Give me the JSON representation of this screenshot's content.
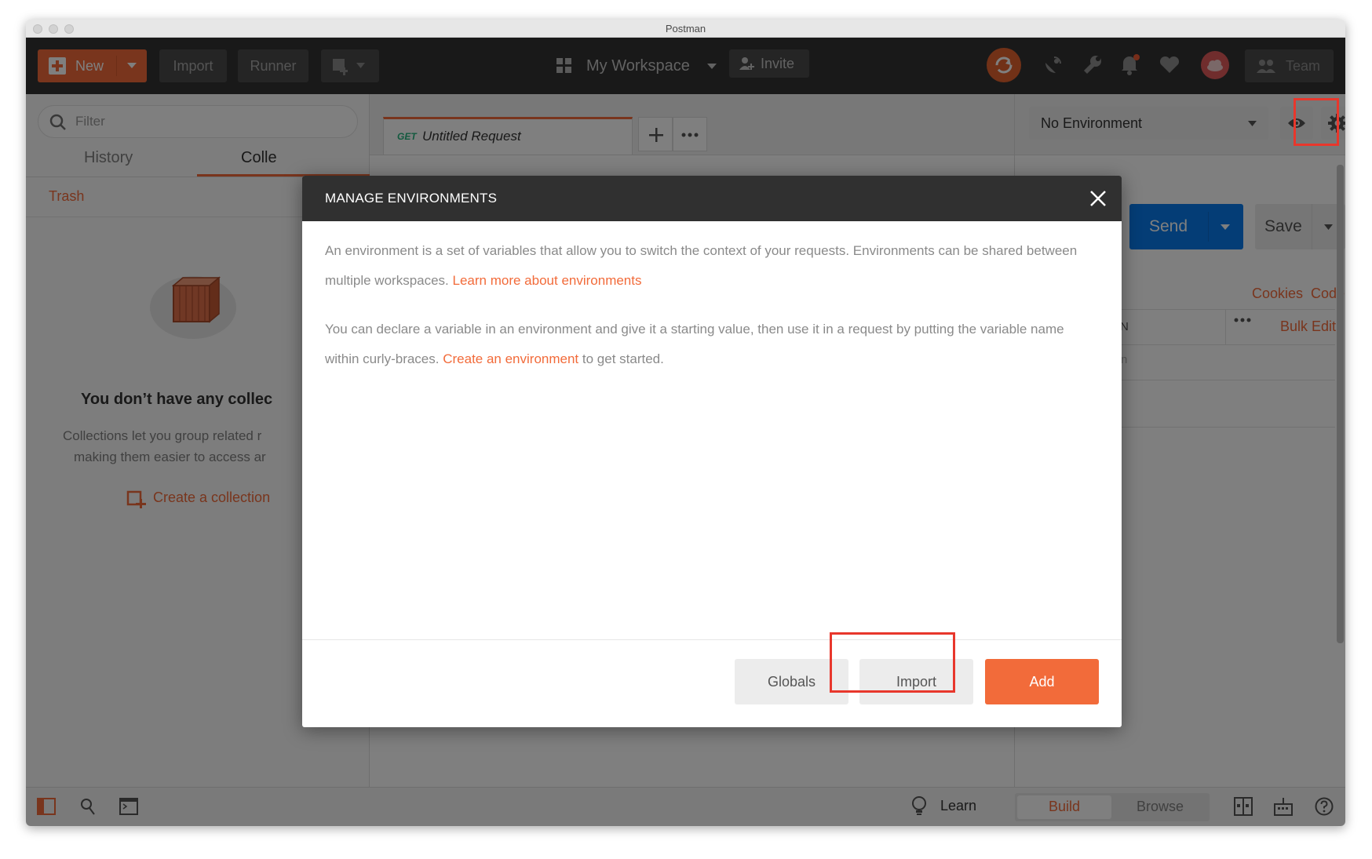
{
  "window": {
    "title": "Postman"
  },
  "header": {
    "new_label": "New",
    "import_label": "Import",
    "runner_label": "Runner",
    "workspace_label": "My Workspace",
    "invite_label": "Invite",
    "team_label": "Team"
  },
  "sidebar": {
    "filter_placeholder": "Filter",
    "tabs": [
      {
        "label": "History"
      },
      {
        "label": "Colle"
      }
    ],
    "trash_label": "Trash",
    "empty_title": "You don’t have any collec",
    "empty_line1": "Collections let you group related r",
    "empty_line2": "making them easier to access ar",
    "create_collection_label": "Create a collection"
  },
  "request_tab": {
    "method": "GET",
    "name": "Untitled Request"
  },
  "environment": {
    "selected": "No Environment"
  },
  "request_panel": {
    "send_label": "Send",
    "save_label": "Save",
    "cookies_label": "Cookies",
    "code_label": "Code",
    "col_fragment": "N",
    "row_fragment": "n",
    "bulk_edit_label": "Bulk Edit"
  },
  "modal": {
    "title": "MANAGE ENVIRONMENTS",
    "p1_text_a": "An environment is a set of variables that allow you to switch the context of your requests. Environments can be shared between multiple workspaces. ",
    "p1_link": "Learn more about environments",
    "p2_text_a": "You can declare a variable in an environment and give it a starting value, then use it in a request by putting the variable name within curly-braces. ",
    "p2_link": "Create an environment",
    "p2_text_b": " to get started.",
    "globals_label": "Globals",
    "import_label": "Import",
    "add_label": "Add"
  },
  "statusbar": {
    "learn_label": "Learn",
    "build_label": "Build",
    "browse_label": "Browse"
  },
  "colors": {
    "accent": "#f26b3a",
    "send_blue": "#097bed",
    "header_bg": "#333333",
    "highlight_red": "#e8372c"
  },
  "icons": [
    "plus-icon",
    "caret-down-icon",
    "grid-icon",
    "add-user-icon",
    "sync-icon",
    "satellite-icon",
    "wrench-icon",
    "bell-icon",
    "heart-icon",
    "cloud-icon",
    "team-icon",
    "search-icon",
    "eye-icon",
    "gear-icon",
    "close-icon",
    "lightbulb-icon",
    "help-icon"
  ]
}
